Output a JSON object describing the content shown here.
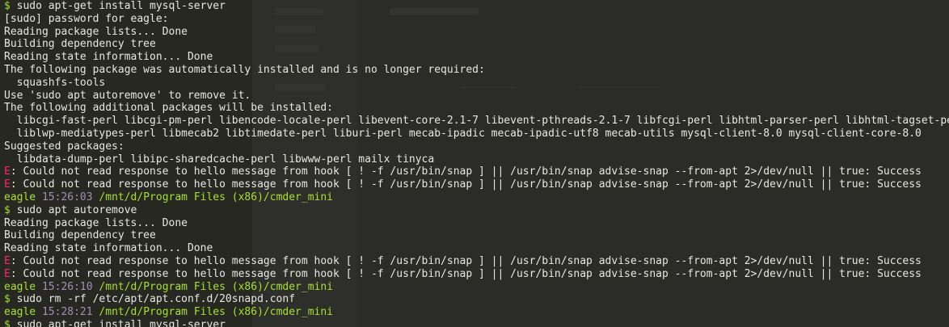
{
  "terminal": {
    "lines": [
      {
        "type": "cmd",
        "symbol": "$",
        "text": " sudo apt-get install mysql-server"
      },
      {
        "type": "out",
        "text": "[sudo] password for eagle:"
      },
      {
        "type": "out",
        "text": "Reading package lists... Done"
      },
      {
        "type": "out",
        "text": "Building dependency tree"
      },
      {
        "type": "out",
        "text": "Reading state information... Done"
      },
      {
        "type": "out",
        "text": "The following package was automatically installed and is no longer required:"
      },
      {
        "type": "out",
        "text": "  squashfs-tools"
      },
      {
        "type": "out",
        "text": "Use 'sudo apt autoremove' to remove it."
      },
      {
        "type": "out",
        "text": "The following additional packages will be installed:"
      },
      {
        "type": "out",
        "text": "  libcgi-fast-perl libcgi-pm-perl libencode-locale-perl libevent-core-2.1-7 libevent-pthreads-2.1-7 libfcgi-perl libhtml-parser-perl libhtml-tagset-perl"
      },
      {
        "type": "out",
        "text": "  liblwp-mediatypes-perl libmecab2 libtimedate-perl liburi-perl mecab-ipadic mecab-ipadic-utf8 mecab-utils mysql-client-8.0 mysql-client-core-8.0"
      },
      {
        "type": "out",
        "text": "Suggested packages:"
      },
      {
        "type": "out",
        "text": "  libdata-dump-perl libipc-sharedcache-perl libwww-perl mailx tinyca"
      },
      {
        "type": "err",
        "prefix": "E",
        "text": ": Could not read response to hello message from hook [ ! -f /usr/bin/snap ] || /usr/bin/snap advise-snap --from-apt 2>/dev/null || true: Success"
      },
      {
        "type": "err",
        "prefix": "E",
        "text": ": Could not read response to hello message from hook [ ! -f /usr/bin/snap ] || /usr/bin/snap advise-snap --from-apt 2>/dev/null || true: Success"
      },
      {
        "type": "prompt",
        "user": "eagle",
        "time": "15:26:03",
        "path": "/mnt/d/Program Files (x86)/cmder_mini"
      },
      {
        "type": "cmd",
        "symbol": "$",
        "text": " sudo apt autoremove"
      },
      {
        "type": "out",
        "text": "Reading package lists... Done"
      },
      {
        "type": "out",
        "text": "Building dependency tree"
      },
      {
        "type": "out",
        "text": "Reading state information... Done"
      },
      {
        "type": "err",
        "prefix": "E",
        "text": ": Could not read response to hello message from hook [ ! -f /usr/bin/snap ] || /usr/bin/snap advise-snap --from-apt 2>/dev/null || true: Success"
      },
      {
        "type": "err",
        "prefix": "E",
        "text": ": Could not read response to hello message from hook [ ! -f /usr/bin/snap ] || /usr/bin/snap advise-snap --from-apt 2>/dev/null || true: Success"
      },
      {
        "type": "prompt",
        "user": "eagle",
        "time": "15:26:10",
        "path": "/mnt/d/Program Files (x86)/cmder_mini"
      },
      {
        "type": "cmd",
        "symbol": "$",
        "text": " sudo rm -rf /etc/apt/apt.conf.d/20snapd.conf"
      },
      {
        "type": "prompt",
        "user": "eagle",
        "time": "15:28:21",
        "path": "/mnt/d/Program Files (x86)/cmder_mini"
      },
      {
        "type": "cmd",
        "symbol": "$",
        "text": " sudo apt-get install mysql-server"
      }
    ]
  },
  "colors": {
    "background": "#272822",
    "text": "#e8e8e2",
    "prompt_green": "#a6e22e",
    "time_purple": "#a48fb8",
    "error_red": "#f92672"
  }
}
